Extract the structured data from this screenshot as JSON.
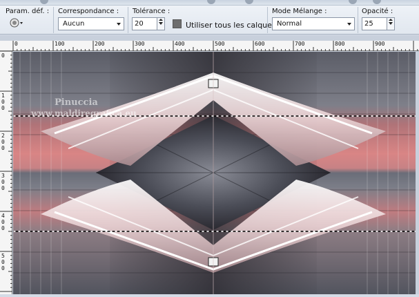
{
  "toolbar": {
    "preset_label": "Param. déf. :",
    "correspondance_label": "Correspondance :",
    "correspondance_value": "Aucun",
    "tolerance_label": "Tolérance :",
    "tolerance_value": "20",
    "use_all_layers_label": "Utiliser tous les calques",
    "blend_mode_label": "Mode Mélange :",
    "blend_mode_value": "Normal",
    "opacity_label": "Opacité :",
    "opacity_value": "25"
  },
  "ruler": {
    "top_labels": [
      "0",
      "100",
      "200",
      "300",
      "400",
      "500",
      "600",
      "700",
      "800",
      "900"
    ],
    "left_labels": [
      "0",
      "1\n0\n0",
      "2\n0\n0",
      "3\n0\n0",
      "4\n0\n0",
      "5\n0\n0"
    ]
  },
  "watermark": {
    "line1": "Pinuccia",
    "line2": "www.maldiregrafica.eu"
  },
  "colors": {
    "pink": "#d98585",
    "gray": "#6a6d78",
    "dark": "#2c2a30"
  }
}
